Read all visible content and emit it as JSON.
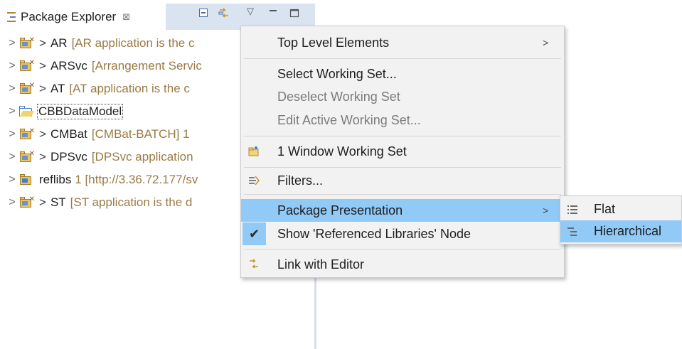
{
  "view": {
    "title": "Package Explorer",
    "close_glyph": "⊠"
  },
  "toolbar": {
    "icons": [
      "collapse-all-icon",
      "link-with-editor-icon",
      "view-menu-icon",
      "minimize-icon",
      "maximize-icon"
    ],
    "menu_glyph": "▽",
    "minimize_glyph": "▭",
    "maximize_glyph": "▢"
  },
  "tree": {
    "items": [
      {
        "expander": ">",
        "icon": "project-icon",
        "prefix": ">",
        "name": "AR",
        "decoration": "[AR application is the c"
      },
      {
        "expander": ">",
        "icon": "project-icon",
        "prefix": ">",
        "name": "ARSvc",
        "decoration": "[Arrangement Servic"
      },
      {
        "expander": ">",
        "icon": "project-icon",
        "prefix": ">",
        "name": "AT",
        "decoration": "[AT application is the c"
      },
      {
        "expander": ">",
        "icon": "folder-icon",
        "prefix": "",
        "name": "CBBDataModel",
        "decoration": ""
      },
      {
        "expander": ">",
        "icon": "project-icon",
        "prefix": ">",
        "name": "CMBat",
        "decoration": "[CMBat-BATCH] 1"
      },
      {
        "expander": ">",
        "icon": "project-icon",
        "prefix": ">",
        "name": "DPSvc",
        "decoration": "[DPSvc application"
      },
      {
        "expander": ">",
        "icon": "library-icon",
        "prefix": "",
        "name": "reflibs",
        "decoration": "1 [http://3.36.72.177/sv"
      },
      {
        "expander": ">",
        "icon": "project-icon",
        "prefix": ">",
        "name": "ST",
        "decoration": "[ST application is the d"
      }
    ]
  },
  "menu": {
    "top_level": "Top Level Elements",
    "select_ws": "Select Working Set...",
    "deselect_ws": "Deselect Working Set",
    "edit_ws": "Edit Active Working Set...",
    "window_ws": "1 Window Working Set",
    "filters": "Filters...",
    "pkg_presentation": "Package Presentation",
    "show_ref_libs": "Show 'Referenced Libraries' Node",
    "link_editor": "Link with Editor",
    "submenu_arrow": ">",
    "check_glyph": "✔"
  },
  "submenu": {
    "flat": "Flat",
    "hierarchical": "Hierarchical"
  },
  "colors": {
    "highlight": "#91c9f7",
    "tabbar": "#dae4f1",
    "decoration_text": "#9a7a45",
    "disabled_text": "#7b7b7b"
  }
}
